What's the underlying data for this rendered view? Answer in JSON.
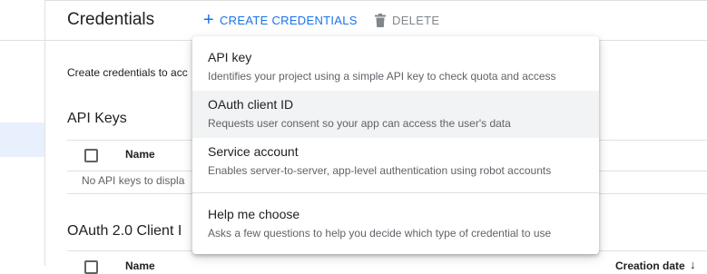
{
  "page": {
    "title": "Credentials",
    "description": "Create credentials to acc"
  },
  "toolbar": {
    "create_label": "CREATE CREDENTIALS",
    "delete_label": "DELETE"
  },
  "api_keys": {
    "title": "API Keys",
    "column_name": "Name",
    "empty_text": "No API keys to displa"
  },
  "oauth": {
    "title": "OAuth 2.0 Client I",
    "column_name": "Name",
    "column_date": "Creation date"
  },
  "menu": {
    "items": [
      {
        "label": "API key",
        "description": "Identifies your project using a simple API key to check quota and access"
      },
      {
        "label": "OAuth client ID",
        "description": "Requests user consent so your app can access the user's data"
      },
      {
        "label": "Service account",
        "description": "Enables server-to-server, app-level authentication using robot accounts"
      },
      {
        "label": "Help me choose",
        "description": "Asks a few questions to help you decide which type of credential to use"
      }
    ],
    "highlighted_index": 1
  },
  "colors": {
    "accent": "#1a73e8",
    "disabled": "#80868b",
    "hover": "#f1f3f4"
  },
  "icons": {
    "create": "plus-icon",
    "delete": "trash-icon",
    "sort": "arrow-down-icon"
  }
}
